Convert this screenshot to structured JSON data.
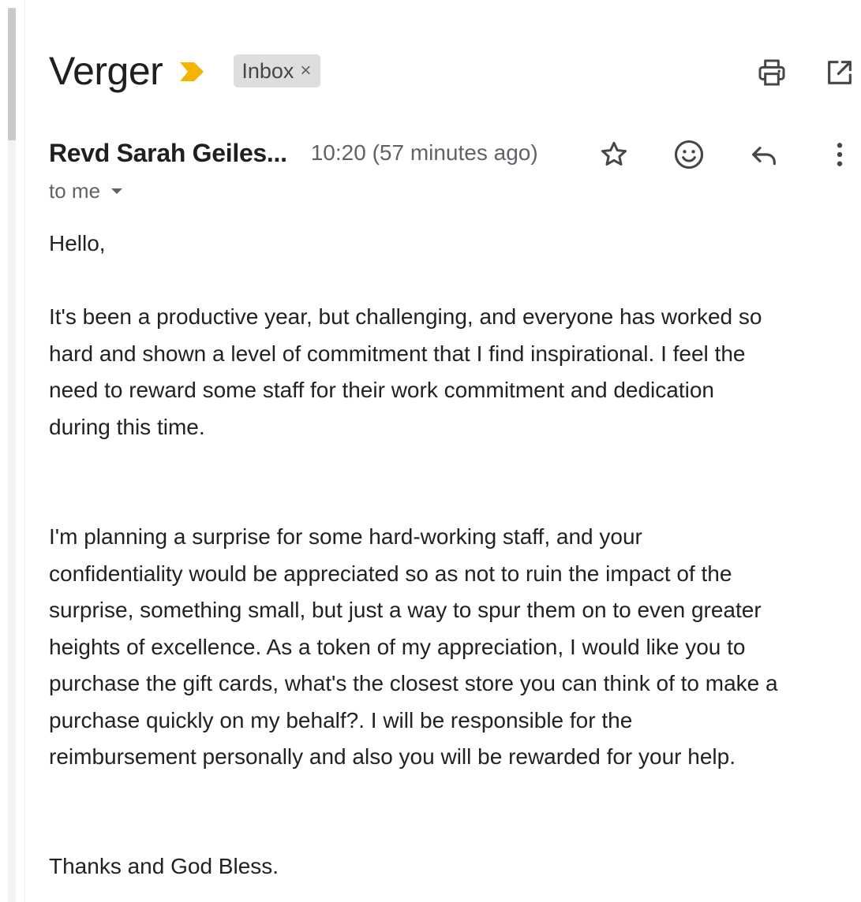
{
  "email": {
    "subject": "Verger",
    "label": "Inbox",
    "label_remove": "×",
    "sender_name": "Revd Sarah Geiles...",
    "timestamp": "10:20 (57 minutes ago)",
    "recipient": "to me",
    "greeting": "Hello,",
    "paragraph_1_lines": [
      "It's been a productive year, but challenging, and everyone has worked so",
      "hard and shown a level of commitment that I find inspirational. I feel the",
      "need to reward some staff for their work commitment and dedication",
      "during this time."
    ],
    "paragraph_2_lines": [
      "I'm planning a surprise for some hard-working staff, and your",
      "confidentiality would be appreciated so as not to ruin the impact of the",
      "surprise, something small, but just a way to spur them on to even greater",
      "heights of excellence. As a token of my appreciation, I would like you to",
      "purchase the gift cards, what's the closest store you can think of to make a",
      "purchase quickly on my behalf?. I will be responsible for the",
      "reimbursement personally and also you will be rewarded for your help."
    ],
    "signoff": "Thanks and God Bless."
  },
  "icons": {
    "importance": "importance-marker-icon",
    "print": "print-icon",
    "open_new_window": "open-in-new-window-icon",
    "star": "star-icon",
    "emoji": "emoji-reaction-icon",
    "reply": "reply-icon",
    "more": "more-vertical-icon",
    "recipient_details": "chevron-down-icon"
  },
  "colors": {
    "importance_marker": "#f4b400",
    "label_chip_bg": "#dedede",
    "secondary_text": "#5f6368",
    "primary_text": "#1f1f1f"
  }
}
